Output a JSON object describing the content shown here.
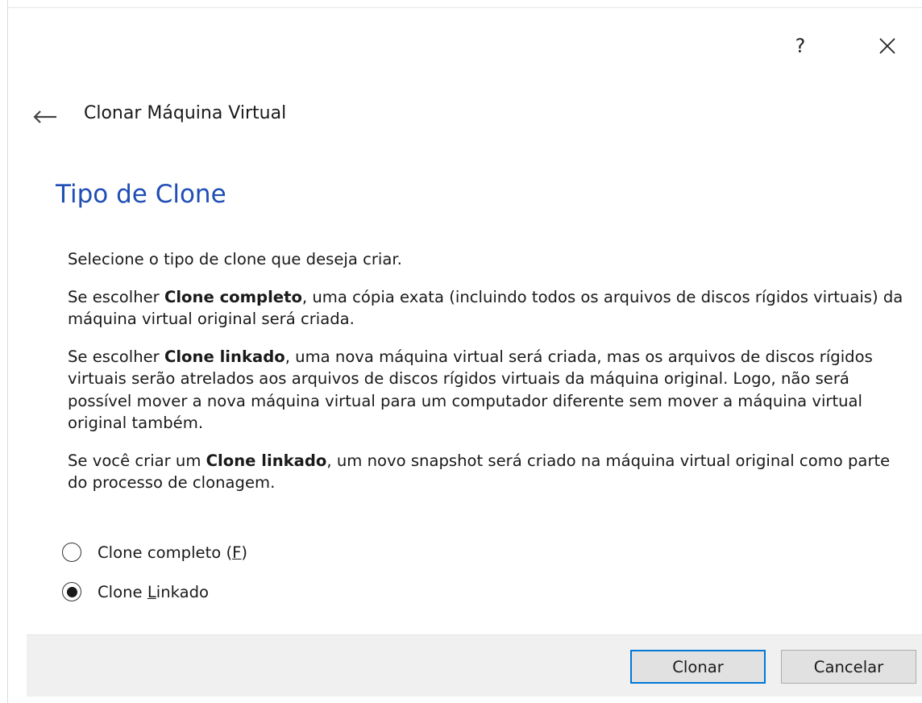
{
  "window": {
    "help_label": "?",
    "close_icon": "close-icon",
    "back_icon": "arrow-left-icon",
    "wizard_title": "Clonar Máquina Virtual"
  },
  "page": {
    "heading": "Tipo de Clone",
    "intro": "Selecione o tipo de clone que deseja criar.",
    "full_clone_para": {
      "prefix": "Se escolher ",
      "bold": "Clone completo",
      "suffix": ", uma cópia exata (incluindo todos os arquivos de discos rígidos virtuais) da máquina virtual original será criada."
    },
    "linked_clone_para": {
      "prefix": "Se escolher ",
      "bold": "Clone linkado",
      "suffix": ", uma nova máquina virtual será criada, mas os arquivos de discos rígidos virtuais serão atrelados aos arquivos de discos rígidos virtuais da máquina original. Logo, não será possível mover a nova máquina virtual para um computador diferente sem mover a máquina virtual original também."
    },
    "snapshot_para": {
      "prefix": "Se você criar um ",
      "bold": "Clone linkado",
      "suffix": ", um novo snapshot será criado na máquina virtual original como parte do processo de clonagem."
    }
  },
  "options": {
    "full_clone": {
      "label_before": "Clone completo (",
      "mnemonic": "F",
      "label_after": ")",
      "selected": false
    },
    "linked_clone": {
      "label_before": "Clone ",
      "mnemonic": "L",
      "label_after": "inkado",
      "selected": true
    }
  },
  "buttons": {
    "clone_label": "Clonar",
    "cancel_label": "Cancelar"
  },
  "colors": {
    "heading": "#1f4eb4",
    "primary_border": "#0078d7",
    "footer_bg": "#f0f0f0"
  }
}
